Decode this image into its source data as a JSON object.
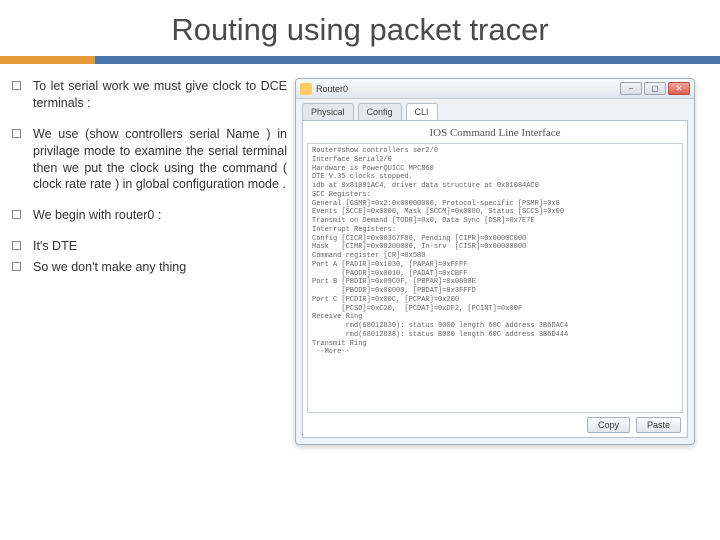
{
  "title": "Routing using packet tracer",
  "bullets": [
    "To let serial work we must give clock to DCE terminals :",
    "We use (show controllers serial Name ) in privilage mode to examine the serial terminal then we put the clock using the command ( clock rate rate ) in global configuration mode .",
    "We begin with router0 :",
    "It's DTE",
    "So we don't make any thing"
  ],
  "window": {
    "title": "Router0",
    "tabs": [
      "Physical",
      "Config",
      "CLI"
    ],
    "active_tab": 2,
    "cli_heading": "IOS Command Line Interface",
    "copy_label": "Copy",
    "paste_label": "Paste",
    "cli_text": "Router#show controllers ser2/0\nInterface Serial2/0\nHardware is PowerQUICC MPC860\nDTE V.35 clocks stopped.\nidb at 0x81081AC4, driver data structure at 0x81084AC0\nSCC Registers:\nGeneral [GSMR]=0x2:0x00000000, Protocol-specific [PSMR]=0x8\nEvents [SCCE]=0x0000, Mask [SCCM]=0x0000, Status [SCCS]=0x00\nTransmit on Demand [TODR]=0x0, Data Sync [DSR]=0x7E7E\nInterrupt Registers:\nConfig [CICR]=0x00367F80, Pending [CIPR]=0x0000C000\nMask   [CIMR]=0x00200000, In-srv  [CISR]=0x00000000\nCommand register [CR]=0x580\nPort A [PADIR]=0x1030, [PAPAR]=0xFFFF\n       [PAODR]=0x0010, [PADAT]=0xCBFF\nPort B [PBDIR]=0x09C0F, [PBPAR]=0x0800E\n       [PBODR]=0x00000, [PBDAT]=0x3FFFD\nPort C [PCDIR]=0x00C, [PCPAR]=0x200\n       [PCSO]=0xC20,  [PCDAT]=0xDF2, [PCINT]=0x00F\nReceive Ring\n        rmd(68012830): status 9000 length 60C address 3B6DAC4\n        rmd(68012838): status B000 length 60C address 3B6D444\nTransmit Ring\n --More--"
  }
}
